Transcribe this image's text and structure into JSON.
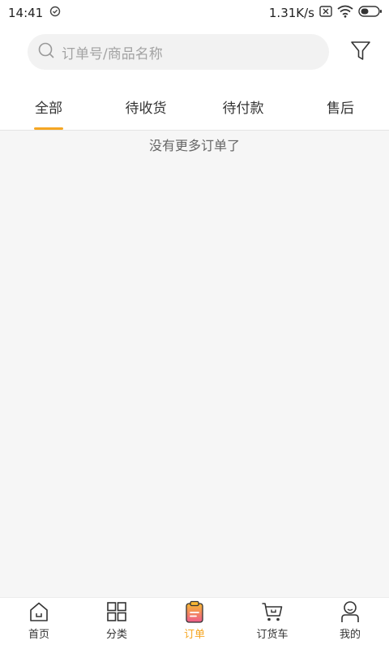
{
  "status_bar": {
    "time": "14:41",
    "network_speed": "1.31K/s",
    "icons": [
      "sync-icon",
      "sim-x-icon",
      "wifi-icon",
      "battery-icon"
    ]
  },
  "search": {
    "placeholder": "订单号/商品名称",
    "icon": "search-icon"
  },
  "filter": {
    "icon": "filter-icon"
  },
  "tabs": [
    {
      "label": "全部",
      "active": true
    },
    {
      "label": "待收货",
      "active": false
    },
    {
      "label": "待付款",
      "active": false
    },
    {
      "label": "售后",
      "active": false
    }
  ],
  "content": {
    "empty_message": "没有更多订单了"
  },
  "bottom_nav": [
    {
      "label": "首页",
      "icon": "home-icon",
      "active": false
    },
    {
      "label": "分类",
      "icon": "grid-icon",
      "active": false
    },
    {
      "label": "订单",
      "icon": "order-clipboard-icon",
      "active": true
    },
    {
      "label": "订货车",
      "icon": "cart-icon",
      "active": false
    },
    {
      "label": "我的",
      "icon": "profile-icon",
      "active": false
    }
  ],
  "colors": {
    "accent": "#f5a623",
    "background": "#f6f6f6",
    "text": "#333333",
    "placeholder": "#a3a3a3"
  }
}
